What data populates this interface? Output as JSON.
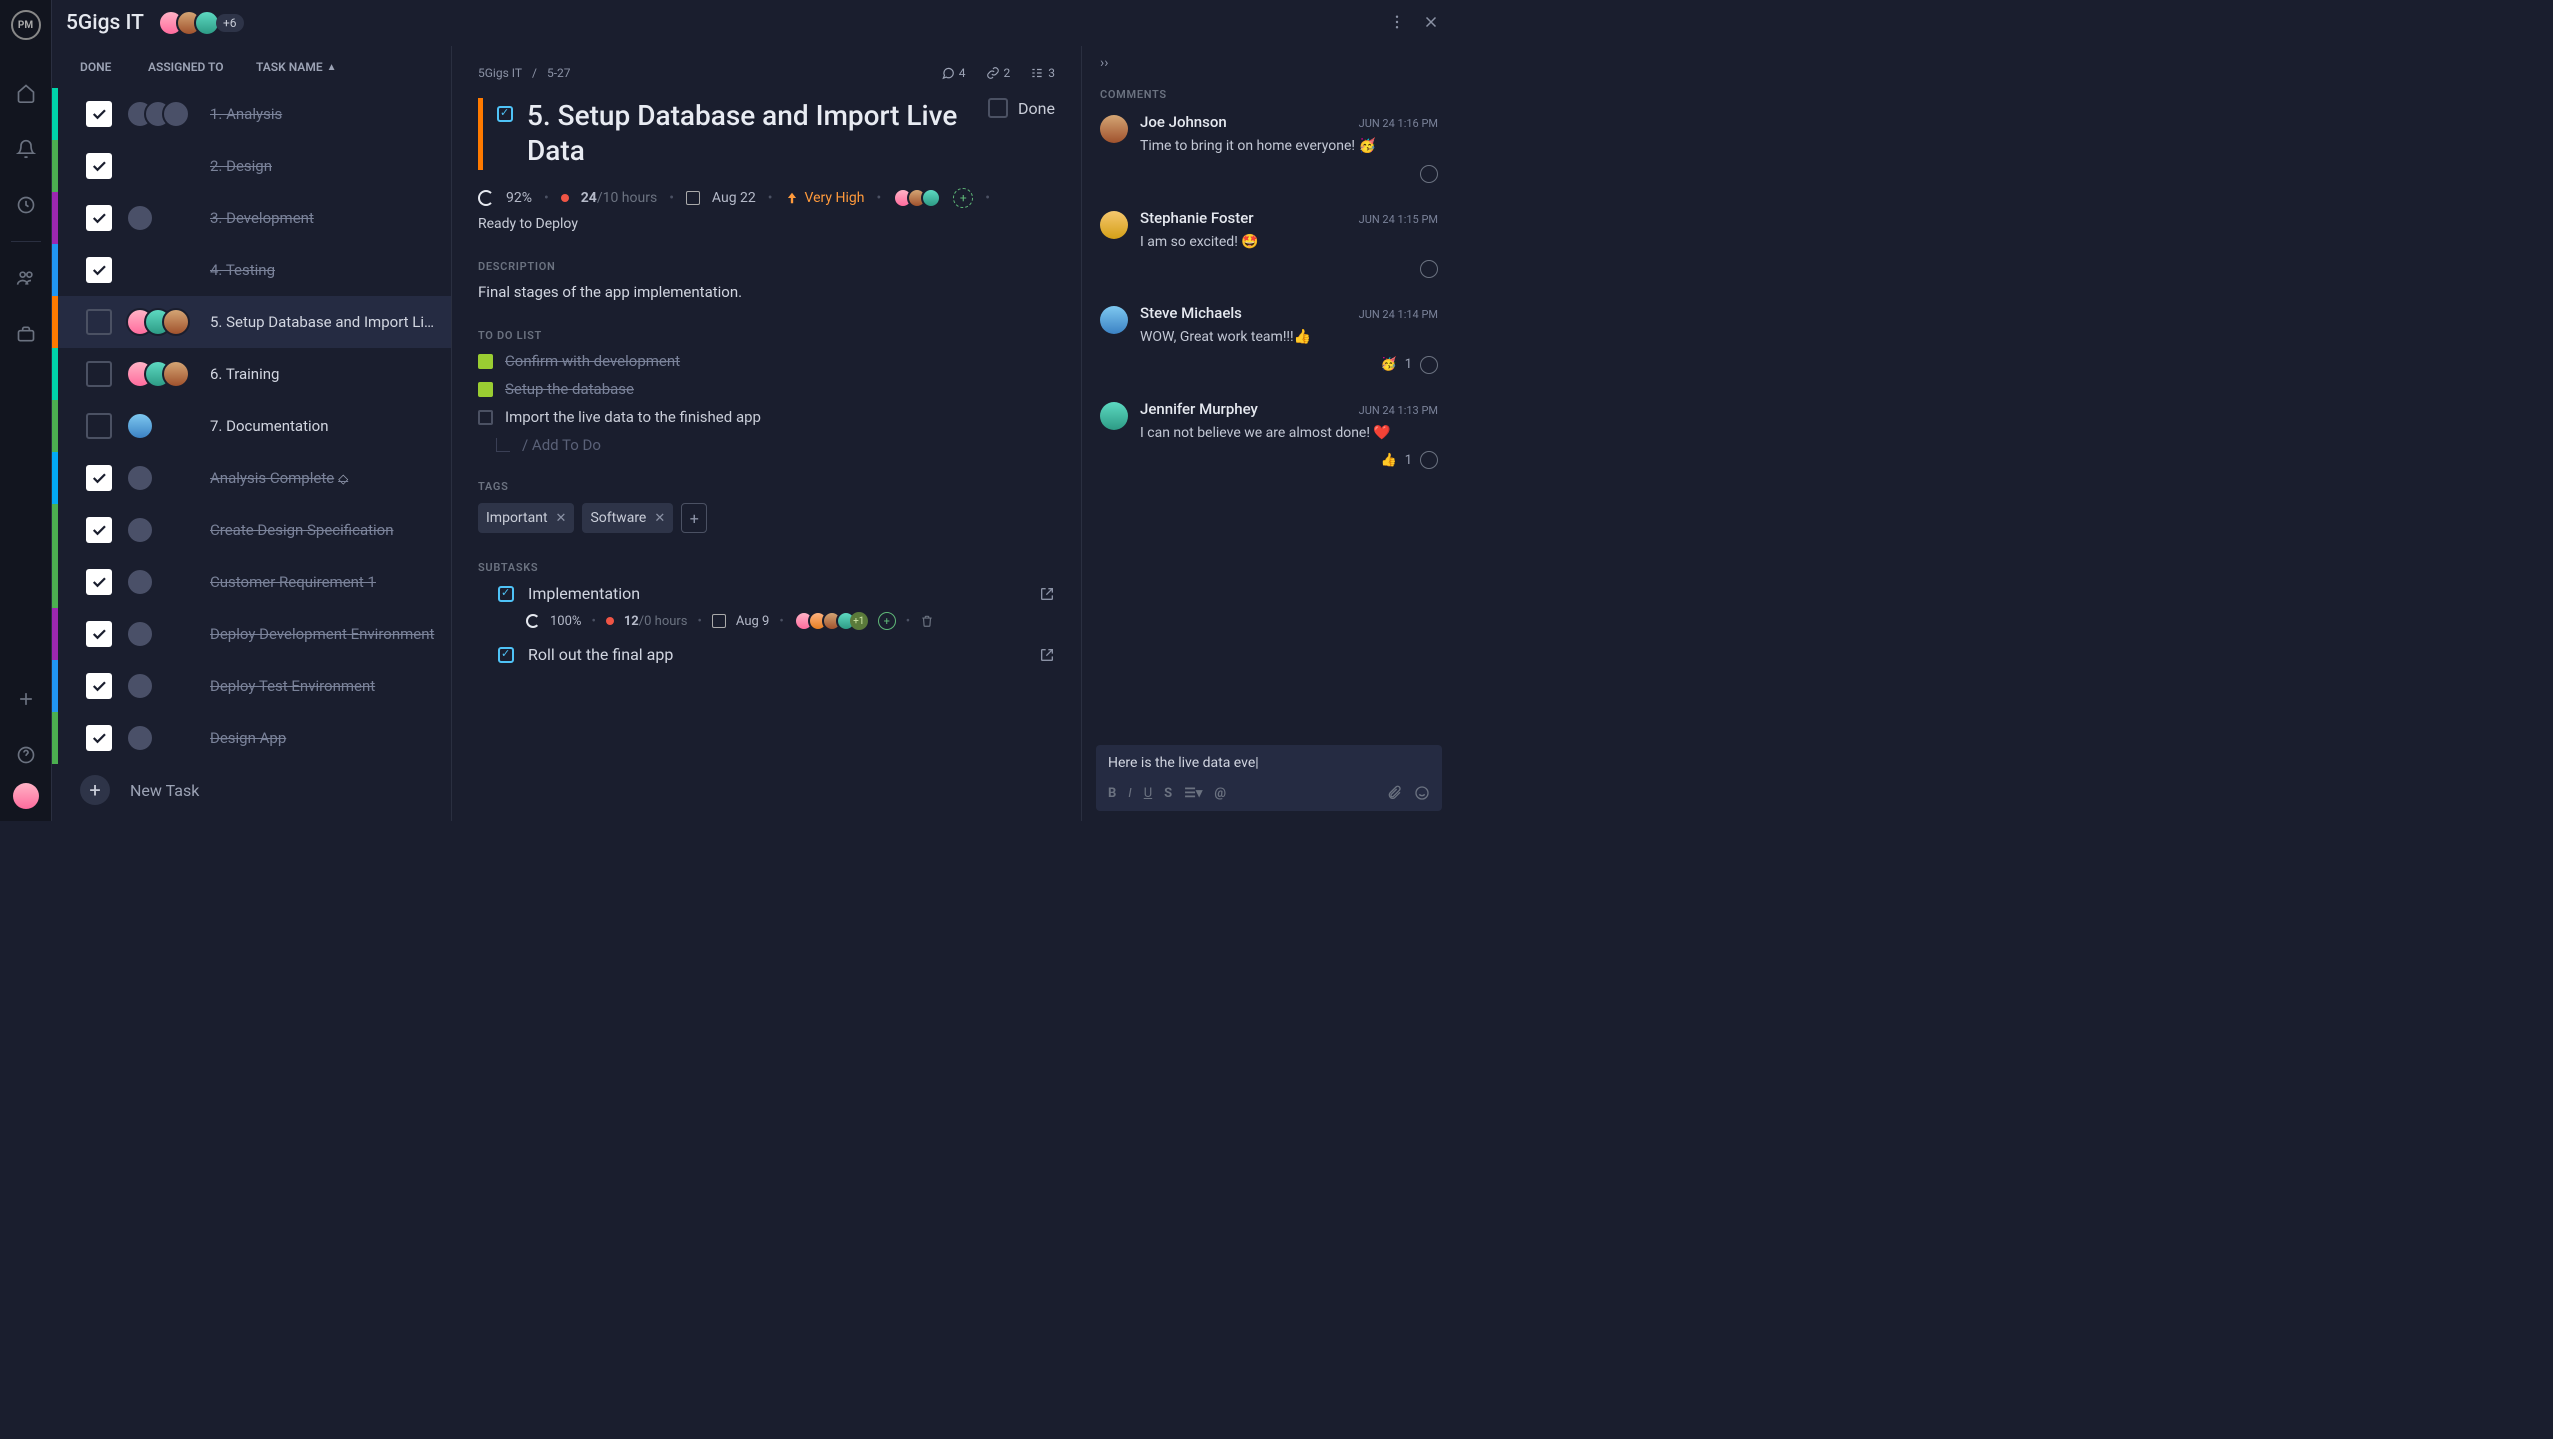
{
  "header": {
    "project_title": "5Gigs IT",
    "more_count": "+6"
  },
  "task_columns": {
    "done": "DONE",
    "assigned": "ASSIGNED TO",
    "name": "TASK NAME"
  },
  "tasks": [
    {
      "color": "cb-teal",
      "done": true,
      "name": "1. Analysis",
      "assignees": [
        "gray",
        "gray",
        "gray"
      ]
    },
    {
      "color": "cb-green",
      "done": true,
      "name": "2. Design",
      "assignees": []
    },
    {
      "color": "cb-purple",
      "done": true,
      "name": "3. Development",
      "assignees": [
        "gray"
      ]
    },
    {
      "color": "cb-blue",
      "done": true,
      "name": "4. Testing",
      "assignees": []
    },
    {
      "color": "cb-orange",
      "done": false,
      "name": "5. Setup Database and Import Live Data",
      "assignees": [
        "pink",
        "teal",
        "brown"
      ],
      "selected": true
    },
    {
      "color": "cb-teal",
      "done": false,
      "name": "6. Training",
      "assignees": [
        "pink",
        "teal",
        "brown"
      ]
    },
    {
      "color": "cb-green",
      "done": false,
      "name": "7. Documentation",
      "assignees": [
        "blue"
      ]
    },
    {
      "color": "cb-blue2",
      "done": true,
      "name": "Analysis Complete",
      "assignees": [
        "gray"
      ],
      "milestone": true
    },
    {
      "color": "cb-green",
      "done": true,
      "name": "Create Design Specification",
      "assignees": [
        "gray"
      ]
    },
    {
      "color": "cb-green",
      "done": true,
      "name": "Customer Requirement 1",
      "assignees": [
        "gray"
      ]
    },
    {
      "color": "cb-purple",
      "done": true,
      "name": "Deploy Development Environment",
      "assignees": [
        "gray"
      ]
    },
    {
      "color": "cb-blue",
      "done": true,
      "name": "Deploy Test Environment",
      "assignees": [
        "gray"
      ]
    },
    {
      "color": "cb-green",
      "done": true,
      "name": "Design App",
      "assignees": [
        "gray"
      ]
    }
  ],
  "tasklist": {
    "new_task": "New Task"
  },
  "detail": {
    "crumb_project": "5Gigs IT",
    "crumb_sep": "/",
    "crumb_id": "5-27",
    "comments_count": "4",
    "links_count": "2",
    "subtasks_count": "3",
    "title": "5. Setup Database and Import Live Data",
    "done_label": "Done",
    "progress": "92%",
    "hours_num": "24",
    "hours_den": "/10 hours",
    "date": "Aug 22",
    "priority": "Very High",
    "status": "Ready to Deploy",
    "desc_label": "DESCRIPTION",
    "description": "Final stages of the app implementation.",
    "todo_label": "TO DO LIST",
    "todos": [
      {
        "done": true,
        "text": "Confirm with development"
      },
      {
        "done": true,
        "text": "Setup the database"
      },
      {
        "done": false,
        "text": "Import the live data to the finished app"
      }
    ],
    "add_todo_placeholder": "/ Add To Do",
    "tags_label": "TAGS",
    "tags": [
      "Important",
      "Software"
    ],
    "subtasks_label": "SUBTASKS",
    "subtasks": [
      {
        "name": "Implementation",
        "progress": "100%",
        "hours_num": "12",
        "hours_den": "/0 hours",
        "date": "Aug 9",
        "assignees": [
          "pink",
          "orange",
          "brown",
          "teal"
        ],
        "extra": "+1"
      },
      {
        "name": "Roll out the final app"
      }
    ]
  },
  "comments_panel": {
    "label": "COMMENTS",
    "items": [
      {
        "avatar": "brown",
        "name": "Joe Johnson",
        "time": "JUN 24 1:16 PM",
        "text": "Time to bring it on home everyone! 🥳"
      },
      {
        "avatar": "amber",
        "name": "Stephanie Foster",
        "time": "JUN 24 1:15 PM",
        "text": "I am so excited! 🤩"
      },
      {
        "avatar": "blue",
        "name": "Steve Michaels",
        "time": "JUN 24 1:14 PM",
        "text": "WOW, Great work team!!!👍",
        "reaction_emoji": "🥳",
        "reaction_count": "1"
      },
      {
        "avatar": "teal",
        "name": "Jennifer Murphey",
        "time": "JUN 24 1:13 PM",
        "text": "I can not believe we are almost done! ❤️",
        "reaction_emoji": "👍",
        "reaction_count": "1"
      }
    ],
    "compose_text": "Here is the live data eve"
  }
}
